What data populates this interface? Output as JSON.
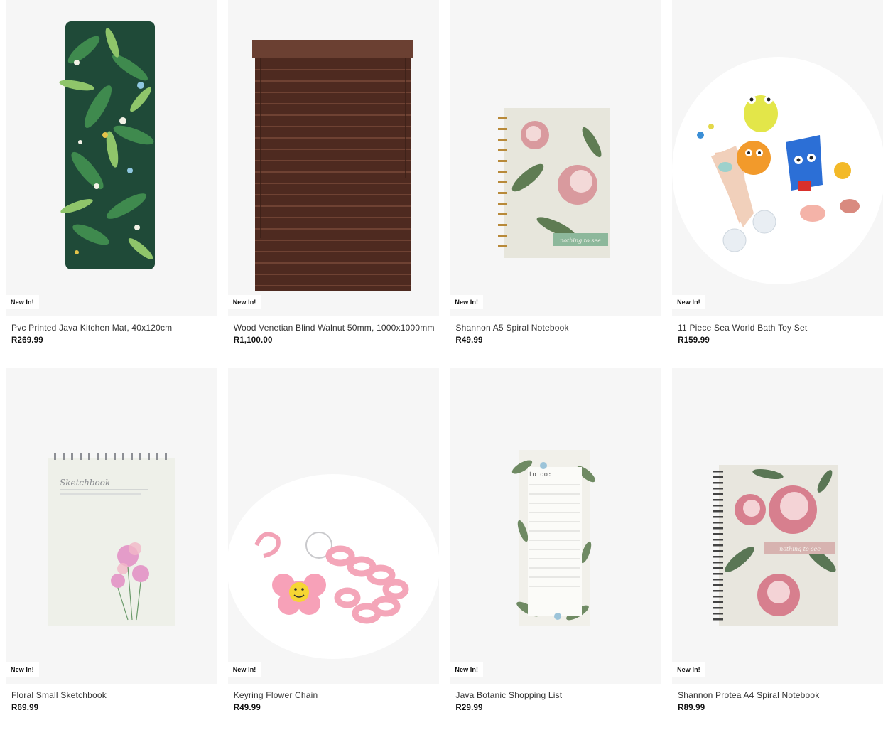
{
  "products": [
    {
      "name": "Pvc Printed Java Kitchen Mat, 40x120cm",
      "price": "R269.99",
      "badge": "New In!",
      "image": "tropical-leaf-kitchen-mat"
    },
    {
      "name": "Wood Venetian Blind Walnut 50mm, 1000x1000mm",
      "price": "R1,100.00",
      "badge": "New In!",
      "image": "walnut-venetian-blind"
    },
    {
      "name": "Shannon A5 Spiral Notebook",
      "price": "R49.99",
      "badge": "New In!",
      "image": "protea-spiral-notebook"
    },
    {
      "name": "11 Piece Sea World Bath Toy Set",
      "price": "R159.99",
      "badge": "New In!",
      "image": "sea-world-bath-toys"
    },
    {
      "name": "Floral Small Sketchbook",
      "price": "R69.99",
      "badge": "New In!",
      "image": "floral-sketchbook"
    },
    {
      "name": "Keyring Flower Chain",
      "price": "R49.99",
      "badge": "New In!",
      "image": "pink-flower-keyring-chain"
    },
    {
      "name": "Java Botanic Shopping List",
      "price": "R29.99",
      "badge": "New In!",
      "image": "botanic-shopping-list-pad"
    },
    {
      "name": "Shannon Protea A4 Spiral Notebook",
      "price": "R89.99",
      "badge": "New In!",
      "image": "protea-a4-spiral-notebook"
    }
  ],
  "imprints": {
    "notebook_a5": "nothing to see",
    "sketchbook": "Sketchbook",
    "shopping_list": "to do:",
    "notebook_a4": "nothing to see"
  }
}
